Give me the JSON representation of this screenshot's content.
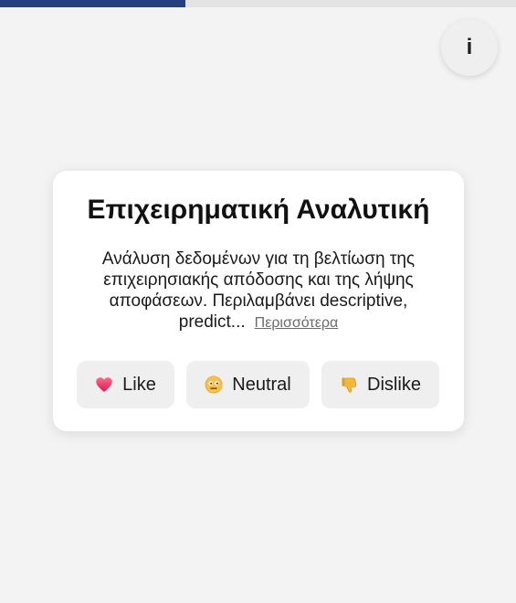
{
  "progress": {
    "fraction": 0.36,
    "fill_color": "#233f7d"
  },
  "info_button": {
    "label": "i"
  },
  "card": {
    "title": "Επιχειρηματική Αναλυτική",
    "description": "Ανάλυση δεδομένων για τη βελτίωση της επιχειρησιακής απόδοσης και της λήψης αποφάσεων. Περιλαμβάνει descriptive, predict...",
    "more_label": "Περισσότερα"
  },
  "buttons": [
    {
      "label": "Like",
      "icon": "heart-icon",
      "color": "#e0245e"
    },
    {
      "label": "Neutral",
      "icon": "neutral-face-icon",
      "color": "#f5b942"
    },
    {
      "label": "Dislike",
      "icon": "thumbs-down-icon",
      "color": "#f0b030"
    }
  ]
}
